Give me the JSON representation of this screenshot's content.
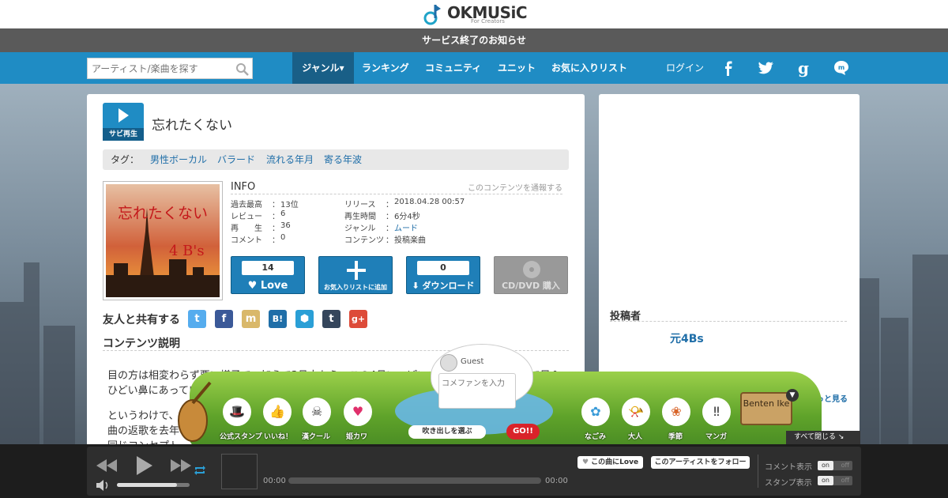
{
  "header": {
    "logo_text": "OKMUSiC",
    "logo_sub": "For Creators",
    "notice": "サービス終了のお知らせ"
  },
  "nav": {
    "search_placeholder": "アーティスト/楽曲を探す",
    "items": [
      "ジャンル▾",
      "ランキング",
      "コミュニティ",
      "ユニット",
      "お気に入りリスト"
    ],
    "login": "ログイン",
    "social_icons": [
      "facebook-icon",
      "twitter-icon",
      "google-icon",
      "mixi-icon"
    ]
  },
  "song": {
    "sabi_label": "サビ再生",
    "title": "忘れたくない",
    "tag_label": "タグ：",
    "tags": [
      "男性ボーカル",
      "バラード",
      "流れる年月",
      "寄る年波"
    ],
    "jacket_title": "忘れたくない",
    "jacket_artist": "4 B's",
    "info_title": "INFO",
    "report_link": "このコンテンツを通報する",
    "info_left": [
      {
        "label": "過去最高",
        "value": "13位"
      },
      {
        "label": "レビュー",
        "value": "6"
      },
      {
        "label": "再　　生",
        "value": "36"
      },
      {
        "label": "コメント",
        "value": "0"
      }
    ],
    "info_right": [
      {
        "label": "リリース",
        "value": "2018.04.28 00:57"
      },
      {
        "label": "再生時間",
        "value": "6分4秒"
      },
      {
        "label": "ジャンル",
        "value": "ムード"
      },
      {
        "label": "コンテンツ",
        "value": "投稿楽曲"
      }
    ],
    "love_count": "14",
    "love_label": "Love",
    "favorite_label": "お気入りリストに追加",
    "download_count": "0",
    "download_label": "ダウンロード",
    "cd_label": "CD/DVD 購入"
  },
  "share": {
    "label": "友人と共有する",
    "buttons": [
      "twitter-share-icon",
      "facebook-share-icon",
      "mixi-share-icon",
      "hatena-share-icon",
      "evernote-share-icon",
      "tumblr-share-icon",
      "google-plus-share-icon"
    ]
  },
  "description": {
    "title": "コンテンツ説明",
    "lines": [
      "目の方は相変わらず悪い様子で、加えて3月末から、この4月いっぱいまで、目も鼻も花粉症で目＆",
      "ひどい鼻にあっていまいましたがまだ完全には治りません(；ω；)か）",
      "というわけで、失礼ながら",
      "曲の返歌を去年",
      "同じコンセプト"
    ]
  },
  "side": {
    "poster_title": "投稿者",
    "poster_name": "元4Bs",
    "more_link": "もっと見る"
  },
  "overlay": {
    "guest": "Guest",
    "comment_placeholder": "コメファンを入力",
    "fukidashi": "吹き出しを選ぶ",
    "go": "GO!!",
    "sign": "Benten Ike",
    "close_all": "すべて閉じる ↘",
    "stamps": [
      "公式スタンプ",
      "いいね！",
      "漢クール",
      "姫カワ",
      "なごみ",
      "大人",
      "季節",
      "マンガ"
    ]
  },
  "player": {
    "time_start": "00:00",
    "time_end": "00:00",
    "love_song": "この曲にLove",
    "follow": "このアーティストをフォロー",
    "comment_display": "コメント表示",
    "stamp_display": "スタンプ表示",
    "on": "on",
    "off": "off",
    "volume": 0.83
  }
}
